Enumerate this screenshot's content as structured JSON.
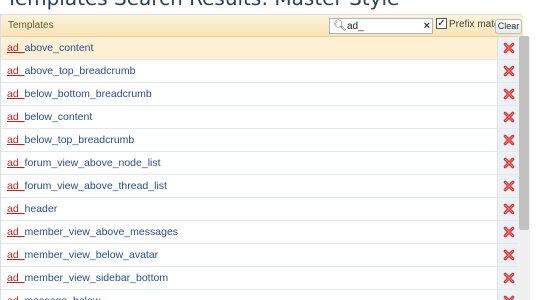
{
  "page": {
    "heading": "Templates Search Results: Master Style"
  },
  "header": {
    "title": "Templates",
    "search_value": "ad_",
    "search_icon": "magnifier-with-dropdown",
    "clear_x": "×",
    "prefix_match_checked": true,
    "prefix_match_label": "Prefix match",
    "clear_label": "Clear"
  },
  "colors": {
    "prefix": "#c0251d",
    "link": "#2a4d8a",
    "highlight": "#fdf0d5",
    "delete": "#d03030"
  },
  "templates": [
    {
      "prefix": "ad_",
      "rest": "above_content"
    },
    {
      "prefix": "ad_",
      "rest": "above_top_breadcrumb"
    },
    {
      "prefix": "ad_",
      "rest": "below_bottom_breadcrumb"
    },
    {
      "prefix": "ad_",
      "rest": "below_content"
    },
    {
      "prefix": "ad_",
      "rest": "below_top_breadcrumb"
    },
    {
      "prefix": "ad_",
      "rest": "forum_view_above_node_list"
    },
    {
      "prefix": "ad_",
      "rest": "forum_view_above_thread_list"
    },
    {
      "prefix": "ad_",
      "rest": "header"
    },
    {
      "prefix": "ad_",
      "rest": "member_view_above_messages"
    },
    {
      "prefix": "ad_",
      "rest": "member_view_below_avatar"
    },
    {
      "prefix": "ad_",
      "rest": "member_view_sidebar_bottom"
    },
    {
      "prefix": "ad_",
      "rest": "message_below"
    }
  ]
}
